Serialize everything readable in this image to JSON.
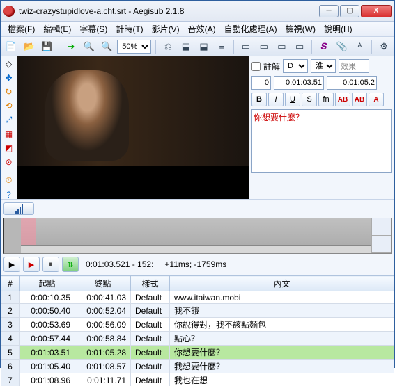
{
  "window": {
    "title": "twiz-crazystupidlove-a.cht.srt - Aegisub 2.1.8"
  },
  "winbtns": {
    "min": "─",
    "max": "▢",
    "close": "X"
  },
  "menu": {
    "file": "檔案(F)",
    "edit": "編輯(E)",
    "subtitle": "字幕(S)",
    "timing": "計時(T)",
    "video": "影片(V)",
    "audio": "音效(A)",
    "auto": "自動化處理(A)",
    "view": "檢視(W)",
    "help": "說明(H)"
  },
  "zoom": "50%",
  "sidebar": {
    "comment_label": "註解",
    "style_sel": "D",
    "actor_sel": "淮",
    "effect": "效果",
    "layer": "0",
    "start": "0:01:03.51",
    "end": "0:01:05.2"
  },
  "fmt": {
    "b": "B",
    "i": "I",
    "u": "U",
    "s": "S",
    "fn": "fn",
    "ab1": "AB",
    "ab2": "AB",
    "ab3": "A"
  },
  "sub_text": "你想要什麼？",
  "playbar": {
    "time_range": "0:01:03.521 - 152:",
    "offsets": "+11ms; -1759ms"
  },
  "grid": {
    "headers": {
      "num": "#",
      "start": "起點",
      "end": "終點",
      "style": "樣式",
      "text": "內文"
    },
    "rows": [
      {
        "n": "1",
        "start": "0:00:10.35",
        "end": "0:00:41.03",
        "style": "Default",
        "text": "www.itaiwan.mobi"
      },
      {
        "n": "2",
        "start": "0:00:50.40",
        "end": "0:00:52.04",
        "style": "Default",
        "text": "我不餓"
      },
      {
        "n": "3",
        "start": "0:00:53.69",
        "end": "0:00:56.09",
        "style": "Default",
        "text": "你說得對，我不該點麵包"
      },
      {
        "n": "4",
        "start": "0:00:57.44",
        "end": "0:00:58.84",
        "style": "Default",
        "text": "點心？"
      },
      {
        "n": "5",
        "start": "0:01:03.51",
        "end": "0:01:05.28",
        "style": "Default",
        "text": "你想要什麼？"
      },
      {
        "n": "6",
        "start": "0:01:05.40",
        "end": "0:01:08.57",
        "style": "Default",
        "text": "我想要什麼？"
      },
      {
        "n": "7",
        "start": "0:01:08.96",
        "end": "0:01:11.71",
        "style": "Default",
        "text": "我也在想"
      }
    ]
  }
}
